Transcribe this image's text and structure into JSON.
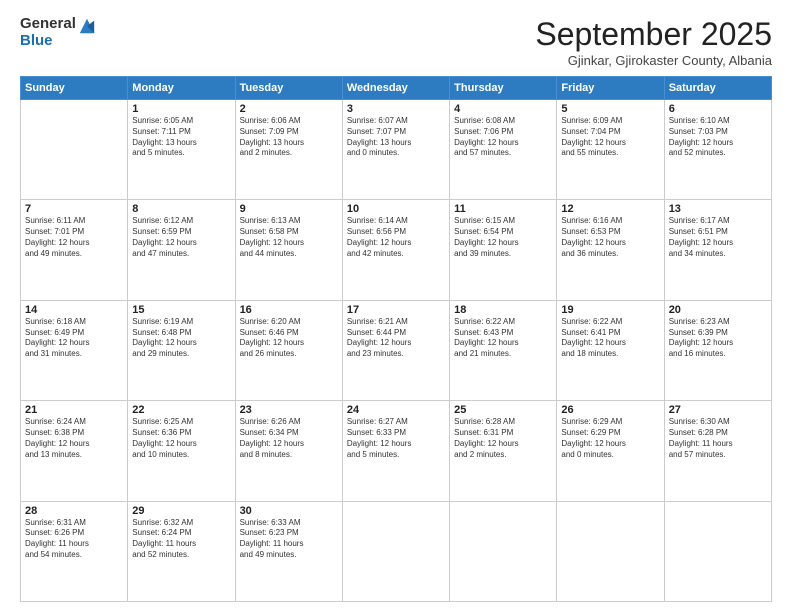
{
  "header": {
    "logo_general": "General",
    "logo_blue": "Blue",
    "month_title": "September 2025",
    "location": "Gjinkar, Gjirokaster County, Albania"
  },
  "days_of_week": [
    "Sunday",
    "Monday",
    "Tuesday",
    "Wednesday",
    "Thursday",
    "Friday",
    "Saturday"
  ],
  "weeks": [
    [
      {
        "day": "",
        "text": ""
      },
      {
        "day": "1",
        "text": "Sunrise: 6:05 AM\nSunset: 7:11 PM\nDaylight: 13 hours\nand 5 minutes."
      },
      {
        "day": "2",
        "text": "Sunrise: 6:06 AM\nSunset: 7:09 PM\nDaylight: 13 hours\nand 2 minutes."
      },
      {
        "day": "3",
        "text": "Sunrise: 6:07 AM\nSunset: 7:07 PM\nDaylight: 13 hours\nand 0 minutes."
      },
      {
        "day": "4",
        "text": "Sunrise: 6:08 AM\nSunset: 7:06 PM\nDaylight: 12 hours\nand 57 minutes."
      },
      {
        "day": "5",
        "text": "Sunrise: 6:09 AM\nSunset: 7:04 PM\nDaylight: 12 hours\nand 55 minutes."
      },
      {
        "day": "6",
        "text": "Sunrise: 6:10 AM\nSunset: 7:03 PM\nDaylight: 12 hours\nand 52 minutes."
      }
    ],
    [
      {
        "day": "7",
        "text": "Sunrise: 6:11 AM\nSunset: 7:01 PM\nDaylight: 12 hours\nand 49 minutes."
      },
      {
        "day": "8",
        "text": "Sunrise: 6:12 AM\nSunset: 6:59 PM\nDaylight: 12 hours\nand 47 minutes."
      },
      {
        "day": "9",
        "text": "Sunrise: 6:13 AM\nSunset: 6:58 PM\nDaylight: 12 hours\nand 44 minutes."
      },
      {
        "day": "10",
        "text": "Sunrise: 6:14 AM\nSunset: 6:56 PM\nDaylight: 12 hours\nand 42 minutes."
      },
      {
        "day": "11",
        "text": "Sunrise: 6:15 AM\nSunset: 6:54 PM\nDaylight: 12 hours\nand 39 minutes."
      },
      {
        "day": "12",
        "text": "Sunrise: 6:16 AM\nSunset: 6:53 PM\nDaylight: 12 hours\nand 36 minutes."
      },
      {
        "day": "13",
        "text": "Sunrise: 6:17 AM\nSunset: 6:51 PM\nDaylight: 12 hours\nand 34 minutes."
      }
    ],
    [
      {
        "day": "14",
        "text": "Sunrise: 6:18 AM\nSunset: 6:49 PM\nDaylight: 12 hours\nand 31 minutes."
      },
      {
        "day": "15",
        "text": "Sunrise: 6:19 AM\nSunset: 6:48 PM\nDaylight: 12 hours\nand 29 minutes."
      },
      {
        "day": "16",
        "text": "Sunrise: 6:20 AM\nSunset: 6:46 PM\nDaylight: 12 hours\nand 26 minutes."
      },
      {
        "day": "17",
        "text": "Sunrise: 6:21 AM\nSunset: 6:44 PM\nDaylight: 12 hours\nand 23 minutes."
      },
      {
        "day": "18",
        "text": "Sunrise: 6:22 AM\nSunset: 6:43 PM\nDaylight: 12 hours\nand 21 minutes."
      },
      {
        "day": "19",
        "text": "Sunrise: 6:22 AM\nSunset: 6:41 PM\nDaylight: 12 hours\nand 18 minutes."
      },
      {
        "day": "20",
        "text": "Sunrise: 6:23 AM\nSunset: 6:39 PM\nDaylight: 12 hours\nand 16 minutes."
      }
    ],
    [
      {
        "day": "21",
        "text": "Sunrise: 6:24 AM\nSunset: 6:38 PM\nDaylight: 12 hours\nand 13 minutes."
      },
      {
        "day": "22",
        "text": "Sunrise: 6:25 AM\nSunset: 6:36 PM\nDaylight: 12 hours\nand 10 minutes."
      },
      {
        "day": "23",
        "text": "Sunrise: 6:26 AM\nSunset: 6:34 PM\nDaylight: 12 hours\nand 8 minutes."
      },
      {
        "day": "24",
        "text": "Sunrise: 6:27 AM\nSunset: 6:33 PM\nDaylight: 12 hours\nand 5 minutes."
      },
      {
        "day": "25",
        "text": "Sunrise: 6:28 AM\nSunset: 6:31 PM\nDaylight: 12 hours\nand 2 minutes."
      },
      {
        "day": "26",
        "text": "Sunrise: 6:29 AM\nSunset: 6:29 PM\nDaylight: 12 hours\nand 0 minutes."
      },
      {
        "day": "27",
        "text": "Sunrise: 6:30 AM\nSunset: 6:28 PM\nDaylight: 11 hours\nand 57 minutes."
      }
    ],
    [
      {
        "day": "28",
        "text": "Sunrise: 6:31 AM\nSunset: 6:26 PM\nDaylight: 11 hours\nand 54 minutes."
      },
      {
        "day": "29",
        "text": "Sunrise: 6:32 AM\nSunset: 6:24 PM\nDaylight: 11 hours\nand 52 minutes."
      },
      {
        "day": "30",
        "text": "Sunrise: 6:33 AM\nSunset: 6:23 PM\nDaylight: 11 hours\nand 49 minutes."
      },
      {
        "day": "",
        "text": ""
      },
      {
        "day": "",
        "text": ""
      },
      {
        "day": "",
        "text": ""
      },
      {
        "day": "",
        "text": ""
      }
    ]
  ]
}
